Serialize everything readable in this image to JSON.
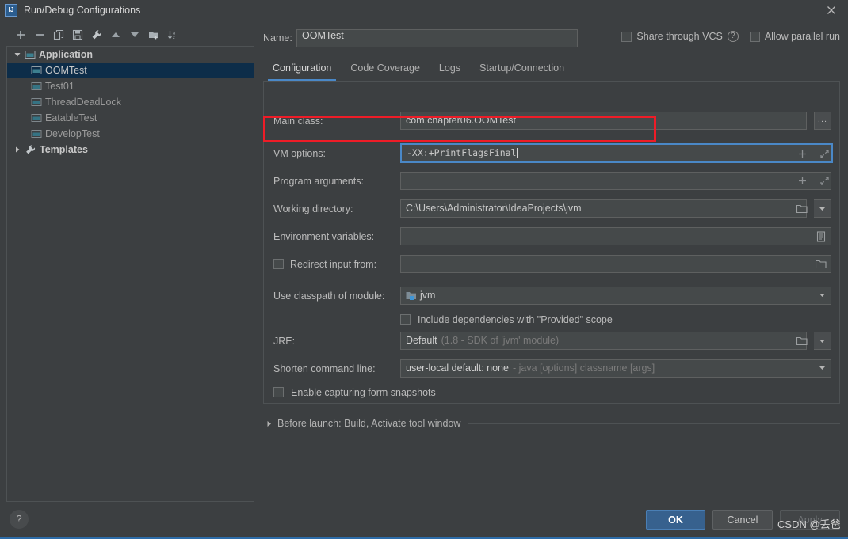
{
  "window": {
    "title": "Run/Debug Configurations",
    "app_icon": "intellij-idea-icon",
    "close_icon": "close-icon"
  },
  "toolbar": {
    "buttons": [
      {
        "name": "add-configuration-button",
        "icon": "plus-icon"
      },
      {
        "name": "remove-configuration-button",
        "icon": "minus-icon"
      },
      {
        "name": "copy-configuration-button",
        "icon": "copy-icon"
      },
      {
        "name": "save-configuration-button",
        "icon": "save-icon"
      },
      {
        "name": "edit-templates-button",
        "icon": "wrench-icon"
      },
      {
        "name": "move-up-button",
        "icon": "arrow-up-icon"
      },
      {
        "name": "move-down-button",
        "icon": "arrow-down-icon"
      },
      {
        "name": "create-folder-button",
        "icon": "new-folder-icon"
      },
      {
        "name": "sort-configurations-button",
        "icon": "sort-az-icon"
      }
    ]
  },
  "tree": {
    "nodes": [
      {
        "label": "Application",
        "type": "group",
        "expanded": true,
        "icon": "application-icon",
        "selected": false,
        "bold": true
      },
      {
        "label": "OOMTest",
        "type": "config",
        "icon": "application-icon",
        "selected": true,
        "bold": false
      },
      {
        "label": "Test01",
        "type": "config",
        "icon": "application-icon",
        "selected": false,
        "bold": false
      },
      {
        "label": "ThreadDeadLock",
        "type": "config",
        "icon": "application-icon",
        "selected": false,
        "bold": false
      },
      {
        "label": "EatableTest",
        "type": "config",
        "icon": "application-icon",
        "selected": false,
        "bold": false
      },
      {
        "label": "DevelopTest",
        "type": "config",
        "icon": "application-icon",
        "selected": false,
        "bold": false
      },
      {
        "label": "Templates",
        "type": "group",
        "expanded": false,
        "icon": "wrench-icon",
        "selected": false,
        "bold": true
      }
    ]
  },
  "header": {
    "name_label": "Name:",
    "name_value": "OOMTest",
    "share_vcs_label": "Share through VCS",
    "share_vcs_checked": false,
    "share_vcs_help_icon": "question-mark-icon",
    "allow_parallel_label": "Allow parallel run",
    "allow_parallel_checked": false
  },
  "tabs": {
    "items": [
      {
        "label": "Configuration",
        "active": true
      },
      {
        "label": "Code Coverage",
        "active": false
      },
      {
        "label": "Logs",
        "active": false
      },
      {
        "label": "Startup/Connection",
        "active": false
      }
    ]
  },
  "form": {
    "main_class": {
      "label": "Main class:",
      "value": "com.chapter06.OOMTest",
      "browse_label": "...",
      "browse_icon": "ellipsis-icon"
    },
    "vm_options": {
      "label": "VM options:",
      "value": "-XX:+PrintFlagsFinal",
      "focused": true,
      "highlighted": true,
      "insert_macro_icon": "plus-icon",
      "expand_icon": "expand-diagonal-icon"
    },
    "program_arguments": {
      "label": "Program arguments:",
      "value": "",
      "insert_macro_icon": "plus-icon",
      "expand_icon": "expand-diagonal-icon"
    },
    "working_directory": {
      "label": "Working directory:",
      "value": "C:\\Users\\Administrator\\IdeaProjects\\jvm",
      "browse_icon": "folder-icon",
      "dropdown_icon": "chevron-down-icon"
    },
    "environment_variables": {
      "label": "Environment variables:",
      "value": "",
      "browse_icon": "list-icon"
    },
    "redirect_input": {
      "label": "Redirect input from:",
      "checked": false,
      "value": "",
      "browse_icon": "folder-icon"
    },
    "classpath_module": {
      "label": "Use classpath of module:",
      "value": "jvm",
      "module_icon": "module-icon",
      "dropdown_icon": "chevron-down-icon"
    },
    "include_provided": {
      "label": "Include dependencies with \"Provided\" scope",
      "checked": false
    },
    "jre": {
      "label": "JRE:",
      "value": "Default",
      "hint": "(1.8 - SDK of 'jvm' module)",
      "browse_icon": "folder-icon",
      "dropdown_icon": "chevron-down-icon"
    },
    "shorten_command_line": {
      "label": "Shorten command line:",
      "value": "user-local default: none",
      "hint": "- java [options] classname [args]",
      "dropdown_icon": "chevron-down-icon"
    },
    "enable_form_snapshots": {
      "label": "Enable capturing form snapshots",
      "checked": false
    }
  },
  "before_launch": {
    "label": "Before launch: Build, Activate tool window",
    "expanded": false,
    "expand_icon": "triangle-right-icon"
  },
  "footer": {
    "help_label": "?",
    "help_icon": "question-mark-icon",
    "ok_label": "OK",
    "cancel_label": "Cancel",
    "apply_label": "Apply",
    "apply_disabled": true,
    "watermark": "CSDN @丢爸"
  },
  "colors": {
    "background": "#3c3f41",
    "field_background": "#45494a",
    "selection": "#0d2d49",
    "accent": "#4a88c7",
    "highlight_red": "#ee1c27",
    "primary_button": "#37618e",
    "bottom_rule": "#2d6ca8"
  }
}
